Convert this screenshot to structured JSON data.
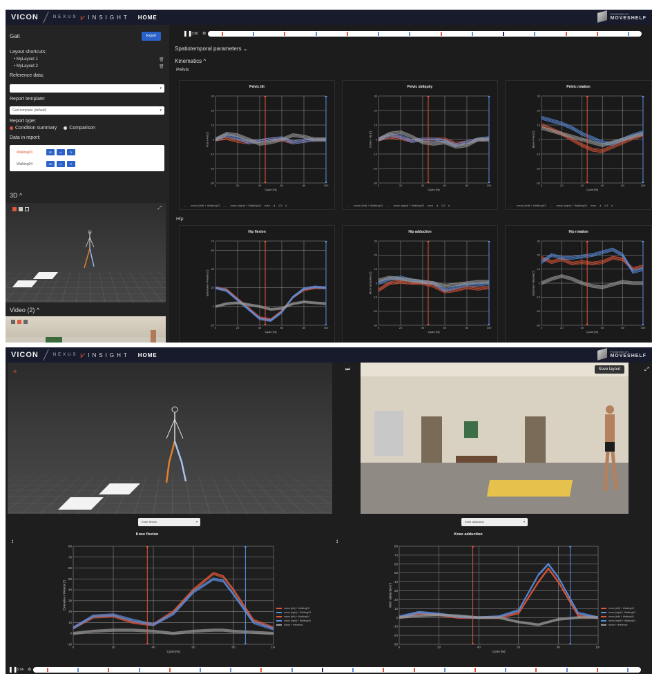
{
  "app": {
    "brand": "VICON",
    "product_nexus": "NEXUS",
    "product_insight": "INSIGHT",
    "home": "HOME",
    "partner_small": "POWERED BY",
    "partner": "MOVESHELF"
  },
  "sidebar": {
    "title": "Gait",
    "export": "Export",
    "layout_shortcuts_label": "Layout shortcuts:",
    "layouts": [
      "• MyLayout 1",
      "• MyLayout 2"
    ],
    "reference_label": "Reference data:",
    "reference_value": "",
    "template_label": "Report template:",
    "template_value": "Gait template (default)",
    "report_type_label": "Report type:",
    "report_types": [
      "Condition summary",
      "Comparison"
    ],
    "data_label": "Data in report:",
    "trials": [
      {
        "name": "Walking03",
        "color": "#e0583a",
        "buttons": [
          "3D",
          "▭",
          "✎"
        ]
      },
      {
        "name": "Walking04",
        "color": "#555555",
        "buttons": [
          "3D",
          "▭",
          "✎"
        ]
      }
    ],
    "section_3d": "3D ^",
    "section_video": "Video (2) ^"
  },
  "main1": {
    "play_time": "3.90",
    "spatiotemporal": "Spatiotemporal parameters ⌄",
    "kinematics": "Kinematics ^",
    "pelvis": "Pelvis",
    "hip": "Hip",
    "legend_left": "mean (left) + Walking03",
    "legend_right": "mean (right) + Walking03",
    "legend_more": "mea",
    "legend_page": "1/3",
    "xlabel": "Cycle [%]"
  },
  "main2": {
    "save_layout": "Save layout",
    "dropdown_left": "Knee flexion",
    "dropdown_right": "Knee adduction",
    "play_time": "3.74",
    "legend": [
      "mean (left) + Walking03",
      "mean (right) + Walking03",
      "mean (left) + Walking04",
      "mean (right) + Walking04",
      "mean + reference"
    ]
  },
  "colors": {
    "left": "#e0583a",
    "right": "#5b8fe0",
    "ref": "#9a9a9a"
  },
  "chart_data": [
    {
      "type": "line",
      "title": "Pelvic tilt",
      "ylabel": "Post / Ant [°]",
      "xlabel": "Cycle [%]",
      "xlim": [
        0,
        100
      ],
      "ylim": [
        -30,
        30
      ],
      "yticks": [
        -30,
        -20,
        -10,
        0,
        10,
        20,
        30
      ],
      "event_left": 45,
      "event_right": 100,
      "x": [
        0,
        10,
        20,
        30,
        40,
        50,
        60,
        70,
        80,
        90,
        100
      ],
      "series": [
        {
          "color": "left",
          "values": [
            0,
            1,
            -1,
            -2,
            -1,
            0,
            0,
            -2,
            -1,
            0,
            0
          ]
        },
        {
          "color": "right",
          "values": [
            0,
            3,
            1,
            -2,
            -1,
            0,
            1,
            -2,
            -1,
            0,
            0
          ]
        },
        {
          "color": "ref",
          "values": [
            0,
            4,
            3,
            0,
            -3,
            -2,
            0,
            3,
            2,
            0,
            0
          ]
        }
      ]
    },
    {
      "type": "line",
      "title": "Pelvic obliquity",
      "ylabel": "Down / Up [°]",
      "xlabel": "Cycle [%]",
      "xlim": [
        0,
        100
      ],
      "ylim": [
        -30,
        30
      ],
      "yticks": [
        -30,
        -20,
        -10,
        0,
        10,
        20,
        30
      ],
      "event_left": 45,
      "event_right": 100,
      "x": [
        0,
        10,
        20,
        30,
        40,
        50,
        60,
        70,
        80,
        90,
        100
      ],
      "series": [
        {
          "color": "left",
          "values": [
            0,
            2,
            1,
            -1,
            0,
            0,
            0,
            -3,
            -2,
            0,
            0
          ]
        },
        {
          "color": "right",
          "values": [
            0,
            3,
            2,
            -1,
            0,
            0,
            -1,
            -4,
            -2,
            0,
            1
          ]
        },
        {
          "color": "ref",
          "values": [
            0,
            4,
            5,
            2,
            -2,
            -3,
            -2,
            -5,
            -4,
            0,
            0
          ]
        }
      ]
    },
    {
      "type": "line",
      "title": "Pelvic rotation",
      "ylabel": "Back / Fwd [°]",
      "xlabel": "Cycle [%]",
      "xlim": [
        0,
        100
      ],
      "ylim": [
        -30,
        30
      ],
      "yticks": [
        -30,
        -20,
        -10,
        0,
        10,
        20,
        30
      ],
      "event_left": 45,
      "event_right": 100,
      "x": [
        0,
        10,
        20,
        30,
        40,
        50,
        60,
        70,
        80,
        90,
        100
      ],
      "series": [
        {
          "color": "left",
          "values": [
            10,
            7,
            4,
            0,
            -4,
            -7,
            -8,
            -5,
            -2,
            1,
            3
          ]
        },
        {
          "color": "right",
          "values": [
            15,
            13,
            11,
            8,
            4,
            1,
            -2,
            -3,
            0,
            3,
            5
          ]
        },
        {
          "color": "ref",
          "values": [
            8,
            6,
            4,
            2,
            0,
            -2,
            -4,
            -2,
            0,
            2,
            4
          ]
        }
      ]
    },
    {
      "type": "line",
      "title": "Hip flexion",
      "ylabel": "Extension / Flexion [°]",
      "xlabel": "Cycle [%]",
      "xlim": [
        0,
        100
      ],
      "ylim": [
        -20,
        70
      ],
      "yticks": [
        -20,
        0,
        20,
        40,
        60,
        70
      ],
      "event_left": 45,
      "event_right": 100,
      "x": [
        0,
        10,
        20,
        30,
        40,
        50,
        60,
        70,
        80,
        90,
        100
      ],
      "series": [
        {
          "color": "left",
          "values": [
            20,
            18,
            8,
            -2,
            -12,
            -14,
            -5,
            10,
            18,
            20,
            20
          ]
        },
        {
          "color": "right",
          "values": [
            20,
            17,
            7,
            -3,
            -13,
            -15,
            -6,
            10,
            19,
            21,
            20
          ]
        },
        {
          "color": "ref",
          "values": [
            0,
            3,
            4,
            2,
            0,
            -3,
            -2,
            3,
            5,
            4,
            3
          ]
        }
      ]
    },
    {
      "type": "line",
      "title": "Hip adduction",
      "ylabel": "Abd / adduction [°]",
      "xlabel": "Cycle [%]",
      "xlim": [
        0,
        100
      ],
      "ylim": [
        -30,
        30
      ],
      "yticks": [
        -30,
        -20,
        -10,
        0,
        10,
        20,
        30
      ],
      "event_left": 45,
      "event_right": 100,
      "x": [
        0,
        10,
        20,
        30,
        40,
        50,
        60,
        70,
        80,
        90,
        100
      ],
      "series": [
        {
          "color": "left",
          "values": [
            -5,
            0,
            1,
            0,
            0,
            -2,
            -6,
            -5,
            -3,
            -4,
            -3
          ]
        },
        {
          "color": "right",
          "values": [
            0,
            3,
            4,
            2,
            1,
            0,
            -5,
            -3,
            -1,
            -1,
            0
          ]
        },
        {
          "color": "ref",
          "values": [
            2,
            4,
            3,
            2,
            1,
            0,
            -2,
            -1,
            0,
            1,
            1
          ]
        }
      ]
    },
    {
      "type": "line",
      "title": "Hip rotation",
      "ylabel": "External / Internal [°]",
      "xlabel": "Cycle [%]",
      "xlim": [
        0,
        100
      ],
      "ylim": [
        -30,
        30
      ],
      "yticks": [
        -30,
        -20,
        -10,
        0,
        10,
        20,
        30
      ],
      "event_left": 45,
      "event_right": 100,
      "x": [
        0,
        10,
        20,
        30,
        40,
        50,
        60,
        70,
        80,
        90,
        100
      ],
      "series": [
        {
          "color": "left",
          "values": [
            18,
            15,
            17,
            14,
            15,
            14,
            15,
            18,
            17,
            10,
            12
          ]
        },
        {
          "color": "right",
          "values": [
            15,
            20,
            18,
            18,
            19,
            20,
            22,
            24,
            20,
            8,
            10
          ]
        },
        {
          "color": "ref",
          "values": [
            0,
            3,
            5,
            3,
            0,
            -2,
            -3,
            -1,
            1,
            0,
            0
          ]
        }
      ]
    },
    {
      "type": "line",
      "title": "Knee flexion",
      "ylabel": "Extension / Flexion [°]",
      "xlabel": "Cycle [%]",
      "xlim": [
        0,
        100
      ],
      "ylim": [
        -10,
        80
      ],
      "yticks": [
        -10,
        0,
        10,
        20,
        30,
        40,
        50,
        60,
        70,
        80
      ],
      "event_left": 37,
      "event_right": 86,
      "x": [
        0,
        10,
        20,
        30,
        40,
        50,
        60,
        70,
        75,
        80,
        90,
        100
      ],
      "series": [
        {
          "color": "left",
          "values": [
            5,
            15,
            16,
            10,
            8,
            20,
            40,
            55,
            52,
            40,
            12,
            5
          ]
        },
        {
          "color": "right",
          "values": [
            5,
            16,
            17,
            12,
            8,
            18,
            38,
            50,
            48,
            36,
            10,
            4
          ]
        },
        {
          "color": "ref",
          "values": [
            0,
            2,
            3,
            3,
            2,
            0,
            2,
            3,
            3,
            2,
            1,
            0
          ]
        }
      ]
    },
    {
      "type": "line",
      "title": "Knee adduction",
      "ylabel": "Abd / adduction [°]",
      "xlabel": "Cycle [%]",
      "xlim": [
        0,
        100
      ],
      "ylim": [
        -30,
        80
      ],
      "yticks": [
        -30,
        -20,
        -10,
        0,
        10,
        20,
        30,
        40,
        50,
        60,
        70,
        80
      ],
      "event_left": 37,
      "event_right": 86,
      "x": [
        0,
        10,
        20,
        30,
        40,
        50,
        60,
        70,
        75,
        80,
        90,
        100
      ],
      "series": [
        {
          "color": "left",
          "values": [
            0,
            5,
            3,
            0,
            0,
            0,
            5,
            40,
            55,
            40,
            2,
            0
          ]
        },
        {
          "color": "right",
          "values": [
            1,
            6,
            4,
            1,
            0,
            1,
            8,
            48,
            60,
            45,
            5,
            0
          ]
        },
        {
          "color": "ref",
          "values": [
            0,
            2,
            3,
            2,
            0,
            0,
            -5,
            -8,
            -5,
            -2,
            0,
            0
          ]
        }
      ]
    }
  ]
}
